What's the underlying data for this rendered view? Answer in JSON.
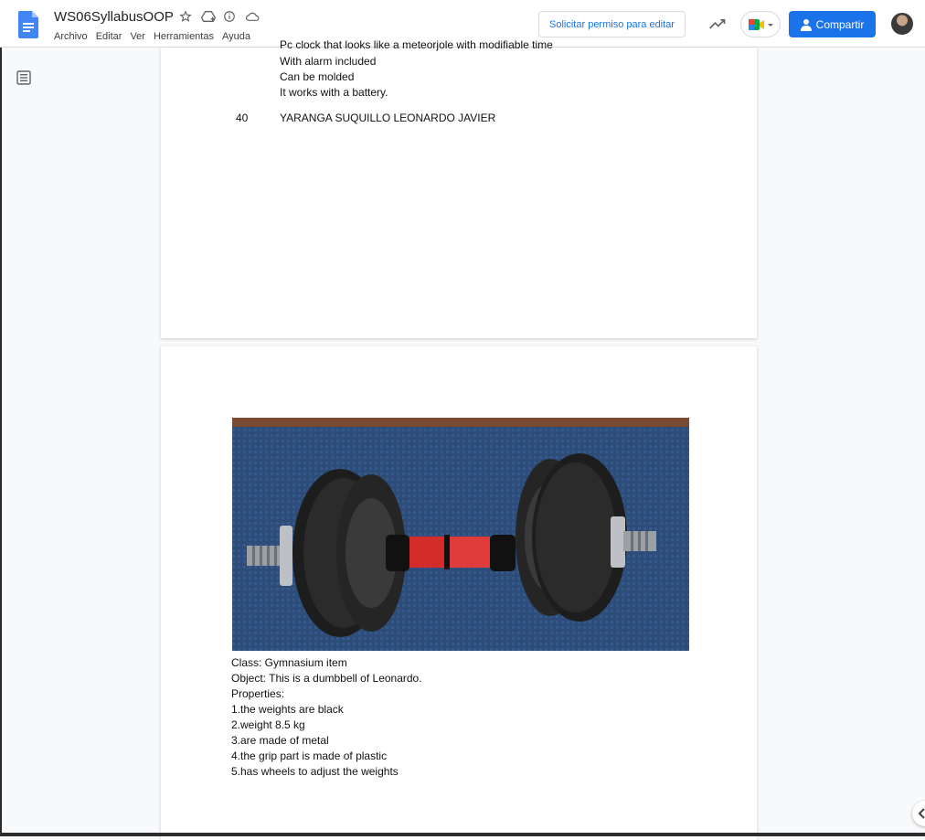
{
  "header": {
    "doc_title": "WS06SyllabusOOP",
    "menu": [
      "Archivo",
      "Editar",
      "Ver",
      "Herramientas",
      "Ayuda"
    ],
    "request_edit_label": "Solicitar permiso para editar",
    "share_label": "Compartir",
    "icons": [
      "docs-logo-icon",
      "star-icon",
      "move-to-drive-icon",
      "info-icon",
      "cloud-saved-icon",
      "activity-trend-icon",
      "meet-camera-icon",
      "share-person-icon"
    ]
  },
  "colors": {
    "accent": "#1a73e8",
    "page": "#ffffff",
    "canvas": "#f8f9fa"
  },
  "page1": {
    "partial_line": "Pc clock that looks like a meteorjole with modifiable time",
    "lines": [
      "With alarm included",
      "Can be molded",
      "It works with a battery."
    ],
    "row_number": "40",
    "row_name": "YARANGA SUQUILLO LEONARDO JAVIER"
  },
  "page2": {
    "image_icon": "dumbbell-photo",
    "lines": [
      "Class: Gymnasium item",
      "Object: This is a dumbbell of Leonardo.",
      "Properties:",
      "1.the weights are black",
      "2.weight 8.5 kg",
      "3.are made of metal",
      "4.the grip part is made of plastic",
      "5.has wheels to adjust the weights"
    ]
  }
}
